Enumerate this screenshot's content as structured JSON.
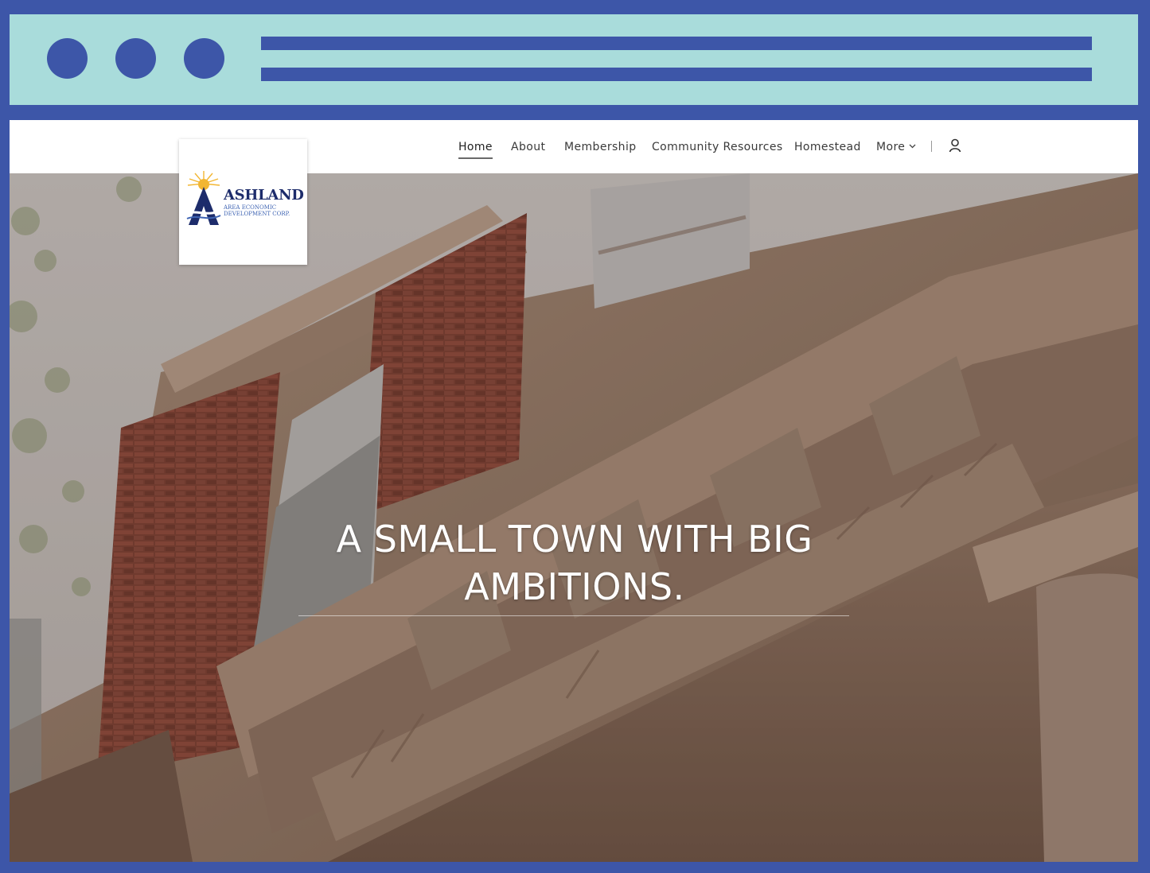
{
  "nav": {
    "items": [
      {
        "label": "Home",
        "active": true
      },
      {
        "label": "About"
      },
      {
        "label": "Membership"
      },
      {
        "label": "Community Resources"
      },
      {
        "label": "Homestead"
      },
      {
        "label": "More"
      }
    ],
    "account_icon": "person-icon",
    "more_icon": "chevron-down-icon"
  },
  "logo": {
    "name": "ASHLAND",
    "subtitle_line1": "AREA ECONOMIC",
    "subtitle_line2": "DEVELOPMENT CORP."
  },
  "hero": {
    "title_line1": "A SMALL TOWN WITH BIG",
    "title_line2": "AMBITIONS."
  },
  "colors": {
    "frame": "#3d56a8",
    "chrome": "#a9dcdb",
    "logo_navy": "#1d2c6b",
    "logo_blue": "#3f64b3",
    "logo_sun": "#f2b632"
  }
}
